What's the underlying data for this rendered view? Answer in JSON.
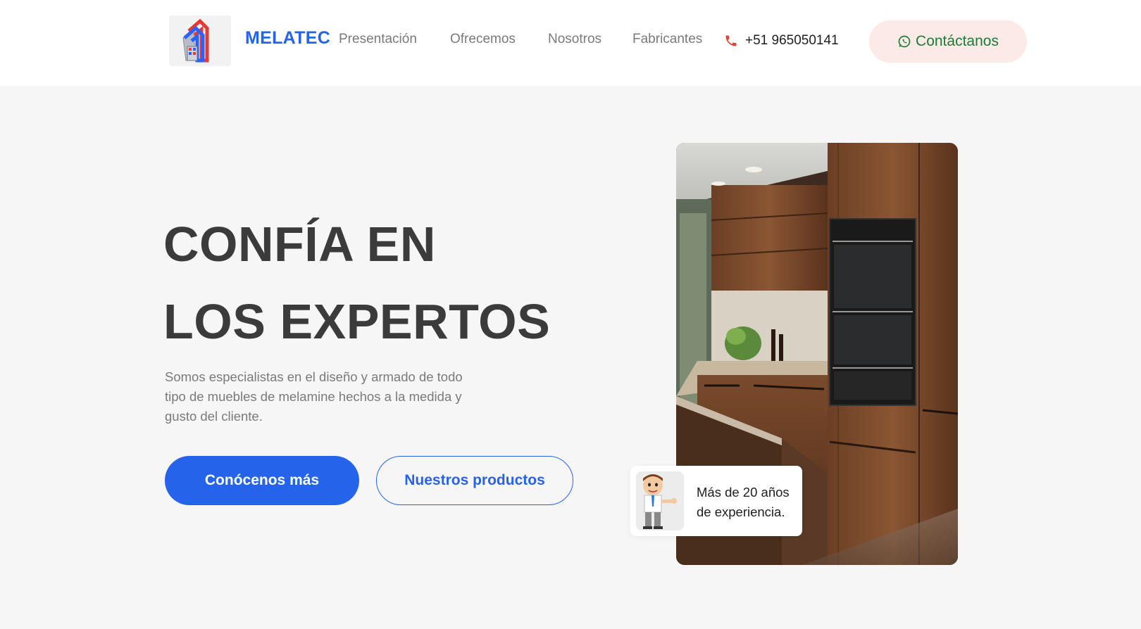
{
  "header": {
    "brand": "MELATEC",
    "nav": [
      "Presentación",
      "Ofrecemos",
      "Nosotros",
      "Fabricantes"
    ],
    "phone": "+51 965050141",
    "contact_label": "Contáctanos"
  },
  "hero": {
    "title_line1": "CONFÍA EN",
    "title_line2": "LOS EXPERTOS",
    "description": "Somos especialistas en el diseño y armado de todo tipo de muebles de melamine hechos a la medida y gusto del cliente.",
    "primary_button": "Conócenos más",
    "secondary_button": "Nuestros productos",
    "experience_text": "Más de 20 años de experiencia."
  },
  "icons": {
    "phone": "phone-icon",
    "whatsapp": "whatsapp-icon",
    "logo": "house-logo-icon"
  },
  "colors": {
    "brand": "#2563eb",
    "heading": "#3b3b3b",
    "muted": "#7a7a7a",
    "contact_bg": "#fbeae5",
    "contact_text": "#1e7a3a",
    "phone_icon": "#e0443a",
    "hero_bg": "#f6f6f6"
  }
}
